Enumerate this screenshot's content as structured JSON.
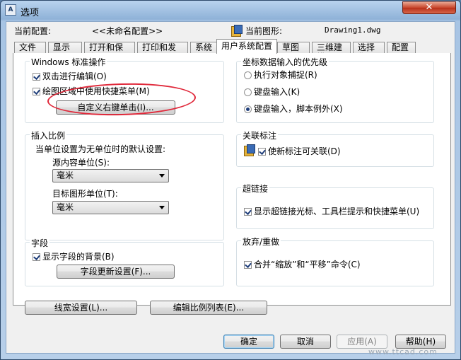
{
  "window": {
    "title": "选项",
    "app_icon_text": "A",
    "close_symbol": "✕"
  },
  "header": {
    "current_profile_label": "当前配置:",
    "current_profile_value": "<<未命名配置>>",
    "current_drawing_label": "当前图形:",
    "current_drawing_value": "Drawing1.dwg"
  },
  "tabs": [
    {
      "label": "文件"
    },
    {
      "label": "显示"
    },
    {
      "label": "打开和保存"
    },
    {
      "label": "打印和发布"
    },
    {
      "label": "系统"
    },
    {
      "label": "用户系统配置",
      "active": true
    },
    {
      "label": "草图"
    },
    {
      "label": "三维建模"
    },
    {
      "label": "选择集"
    },
    {
      "label": "配置"
    }
  ],
  "windows_standard": {
    "title": "Windows 标准操作",
    "double_click_edit": {
      "label": "双击进行编辑(O)",
      "checked": true
    },
    "shortcut_menu": {
      "label": "绘图区域中使用快捷菜单(M)",
      "checked": true
    },
    "right_click_button": "自定义右键单击(I)..."
  },
  "insertion_scale": {
    "title": "插入比例",
    "description": "当单位设置为无单位时的默认设置:",
    "source_label": "源内容单位(S):",
    "source_value": "毫米",
    "target_label": "目标图形单位(T):",
    "target_value": "毫米"
  },
  "fields": {
    "title": "字段",
    "background": {
      "label": "显示字段的背景(B)",
      "checked": true
    },
    "update_button": "字段更新设置(F)..."
  },
  "coordinate_priority": {
    "title": "坐标数据输入的优先级",
    "options": [
      {
        "label": "执行对象捕捉(R)",
        "checked": false
      },
      {
        "label": "键盘输入(K)",
        "checked": false
      },
      {
        "label": "键盘输入，脚本例外(X)",
        "checked": true
      }
    ]
  },
  "associative_dim": {
    "title": "关联标注",
    "make_associative": {
      "label": "使新标注可关联(D)",
      "checked": true
    }
  },
  "hyperlink": {
    "title": "超链接",
    "show_cursor": {
      "label": "显示超链接光标、工具栏提示和快捷菜单(U)",
      "checked": true
    }
  },
  "undo_redo": {
    "title": "放弃/重做",
    "combine": {
      "label": "合并“缩放”和“平移”命令(C)",
      "checked": true
    }
  },
  "bottom_buttons": {
    "lineweight": "线宽设置(L)...",
    "scale_list": "编辑比例列表(E)..."
  },
  "dialog_buttons": {
    "ok": "确定",
    "cancel": "取消",
    "apply": "应用(A)",
    "help": "帮助(H)"
  },
  "watermark": "www.ttcad.com"
}
